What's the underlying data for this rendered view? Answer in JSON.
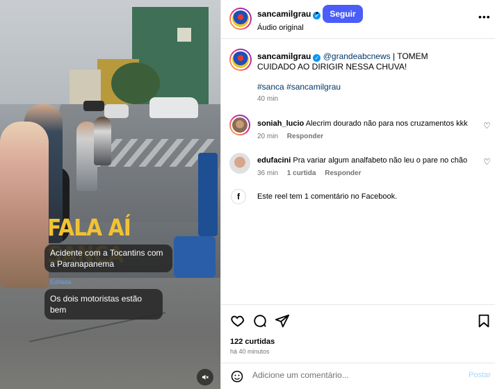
{
  "video": {
    "overlay_title": "FALA AÍ SANCA",
    "bubble1": "Acidente com a Tocantins com a Paranapanema",
    "edited_label": "Editada",
    "bubble2": "Os dois motoristas estão bem",
    "mute_icon": "speaker-muted-icon"
  },
  "header": {
    "username": "sancamilgrau",
    "dot": "•",
    "follow_label": "Seguir",
    "audio": "Áudio original",
    "more": "•••"
  },
  "caption": {
    "username": "sancamilgrau",
    "mention": "@grandeabcnews",
    "text": " | TOMEM CUIDADO AO DIRIGIR NESSA CHUVA!",
    "hashtags": "#sanca #sancamilgrau",
    "time": "40 min"
  },
  "comments": [
    {
      "username": "soniah_lucio",
      "text": "Alecrim dourado não para nos cruzamentos kkk",
      "time": "20 min",
      "likes": "",
      "reply": "Responder"
    },
    {
      "username": "edufacini",
      "text": "Pra variar algum analfabeto não leu o pare no chão",
      "time": "36 min",
      "likes": "1 curtida",
      "reply": "Responder"
    }
  ],
  "facebook_note": "Este reel tem 1 comentário no Facebook.",
  "actions": {
    "likes": "122 curtidas",
    "ago": "há 40 minutos"
  },
  "add_comment": {
    "placeholder": "Adicione um comentário...",
    "post_label": "Postar"
  },
  "colors": {
    "follow_button": "#4a5df9",
    "link_blue": "#00376b",
    "overlay_yellow": "#f2c234",
    "verified": "#0095f6"
  }
}
